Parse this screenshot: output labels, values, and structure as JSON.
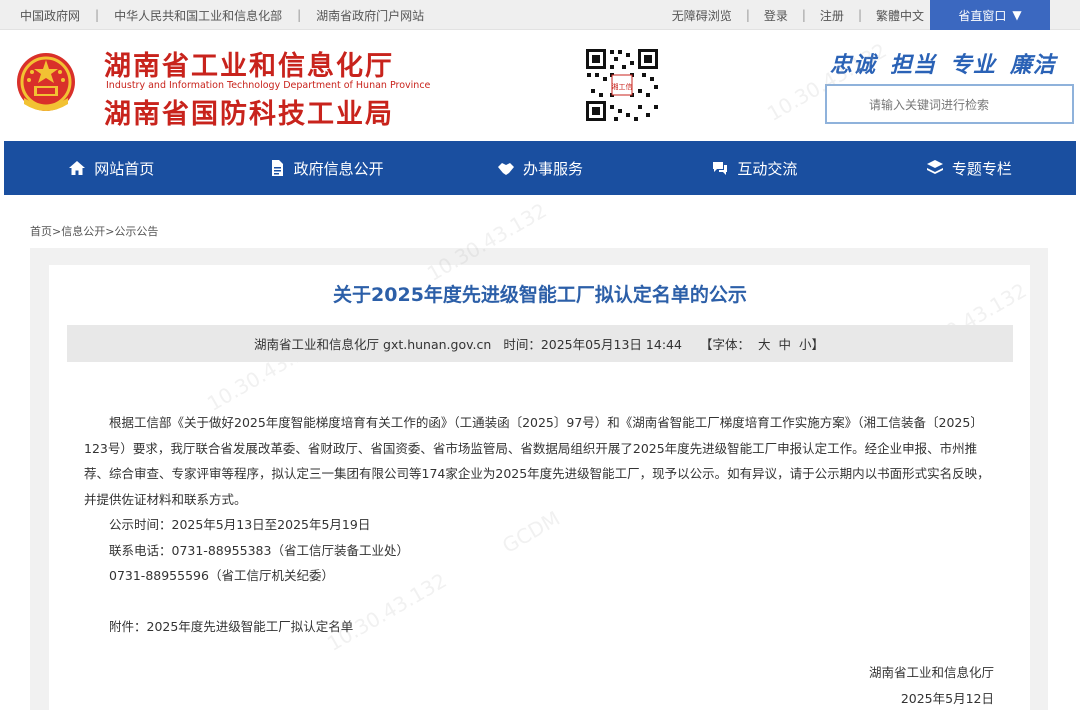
{
  "topbar": {
    "links": [
      "中国政府网",
      "中华人民共和国工业和信息化部",
      "湖南省政府门户网站"
    ],
    "right_links": [
      "无障碍浏览",
      "登录",
      "注册",
      "繁體中文"
    ],
    "region_button": "省直窗口",
    "region_arrow": "▼"
  },
  "header": {
    "org_name_1": "湖南省工业和信息化厅",
    "org_en": "Industry and Information Technology Department of Hunan Province",
    "org_name_2": "湖南省国防科技工业局",
    "motto": [
      "忠诚",
      "担当",
      "专业",
      "廉洁"
    ],
    "search_placeholder": "请输入关键词进行检索",
    "qr_caption": "湘工信"
  },
  "nav": {
    "items": [
      {
        "label": "网站首页",
        "icon": "home-icon"
      },
      {
        "label": "政府信息公开",
        "icon": "document-icon"
      },
      {
        "label": "办事服务",
        "icon": "handshake-icon"
      },
      {
        "label": "互动交流",
        "icon": "chat-icon"
      },
      {
        "label": "专题专栏",
        "icon": "layers-icon"
      }
    ]
  },
  "breadcrumb": "首页>信息公开>公示公告",
  "article": {
    "title": "关于2025年度先进级智能工厂拟认定名单的公示",
    "source": "湖南省工业和信息化厅 gxt.hunan.gov.cn",
    "time": "时间：2025年05月13日 14:44",
    "font_label": "【字体：",
    "font_large": "大",
    "font_medium": "中",
    "font_small": "小】",
    "paragraph": "根据工信部《关于做好2025年度智能梯度培育有关工作的函》（工通装函〔2025〕97号）和《湖南省智能工厂梯度培育工作实施方案》（湘工信装备〔2025〕123号）要求，我厅联合省发展改革委、省财政厅、省国资委、省市场监管局、省数据局组织开展了2025年度先进级智能工厂申报认定工作。经企业申报、市州推荐、综合审查、专家评审等程序，拟认定三一集团有限公司等174家企业为2025年度先进级智能工厂，现予以公示。如有异议，请于公示期内以书面形式实名反映，并提供佐证材料和联系方式。",
    "period": "公示时间：2025年5月13日至2025年5月19日",
    "contact_1": "联系电话：0731-88955383（省工信厅装备工业处）",
    "contact_2": "0731-88955596（省工信厅机关纪委）",
    "attachment": "附件：2025年度先进级智能工厂拟认定名单",
    "sign_org": "湖南省工业和信息化厅",
    "sign_date": "2025年5月12日"
  },
  "colors": {
    "nav_bg": "#1a4fa0",
    "title_blue": "#2c5fa8",
    "org_red": "#c8231c",
    "region_btn": "#3b68c0"
  }
}
